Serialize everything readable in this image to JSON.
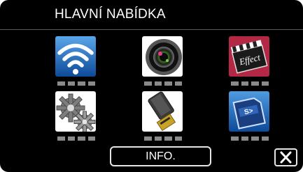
{
  "header": {
    "title": "HLAVNÍ NABÍDKA"
  },
  "menu": {
    "items": [
      {
        "icon": "wifi-icon"
      },
      {
        "icon": "camera-lens-icon"
      },
      {
        "icon": "effect-clapperboard-icon"
      },
      {
        "icon": "settings-gears-icon"
      },
      {
        "icon": "hdmi-connector-icon"
      },
      {
        "icon": "sd-card-icon"
      }
    ]
  },
  "footer": {
    "info_label": "INFO.",
    "close_icon": "close-icon"
  },
  "colors": {
    "background": "#000000",
    "accent_blue": "#1a5fae",
    "accent_red": "#a51e3a",
    "border": "#e6e6e6"
  }
}
